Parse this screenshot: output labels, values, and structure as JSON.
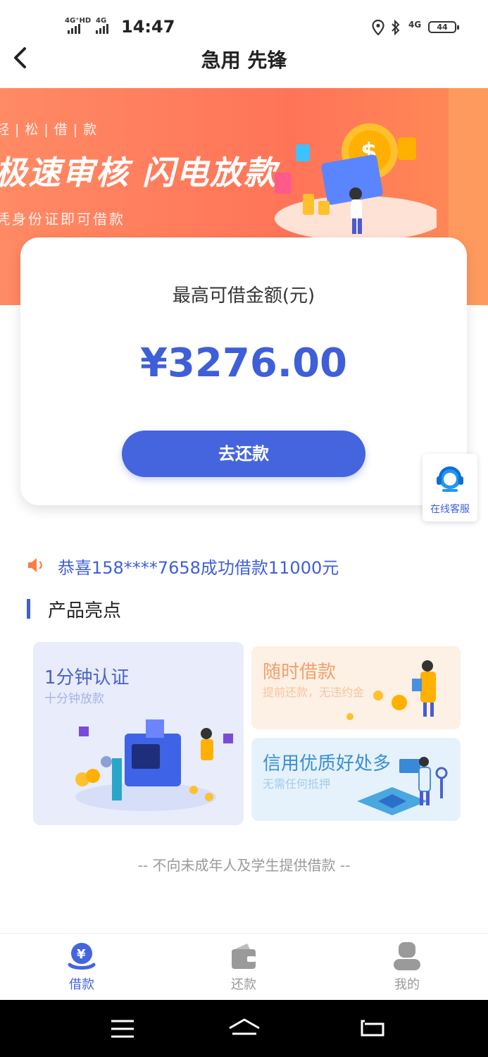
{
  "status_bar": {
    "sim1": "4G⁺HD",
    "sim2": "4G",
    "time": "14:47",
    "network": "4G",
    "battery": "44"
  },
  "header": {
    "title": "急用 先锋"
  },
  "banner": {
    "tag": "轻|松|借|款",
    "title": "极速审核 闪电放款",
    "subtitle": "凭身份证即可借款"
  },
  "card": {
    "label": "最高可借金额(元)",
    "amount": "¥3276.00",
    "button": "去还款"
  },
  "service": {
    "label": "在线客服"
  },
  "notice": {
    "text": "恭喜158****7658成功借款11000元"
  },
  "section": {
    "title": "产品亮点"
  },
  "features": [
    {
      "title": "1分钟认证",
      "subtitle": "十分钟放款"
    },
    {
      "title": "随时借款",
      "subtitle": "提前还款，无违约金"
    },
    {
      "title": "信用优质好处多",
      "subtitle": "无需任何抵押"
    }
  ],
  "disclaimer": "-- 不向未成年人及学生提供借款 --",
  "tabs": [
    {
      "label": "借款",
      "icon": "loan-icon",
      "active": true
    },
    {
      "label": "还款",
      "icon": "wallet-icon",
      "active": false
    },
    {
      "label": "我的",
      "icon": "user-icon",
      "active": false
    }
  ],
  "colors": {
    "primary": "#4465dd",
    "banner": "#ff7458",
    "notice": "#3f5fd8",
    "inactive_tab": "#999999"
  }
}
